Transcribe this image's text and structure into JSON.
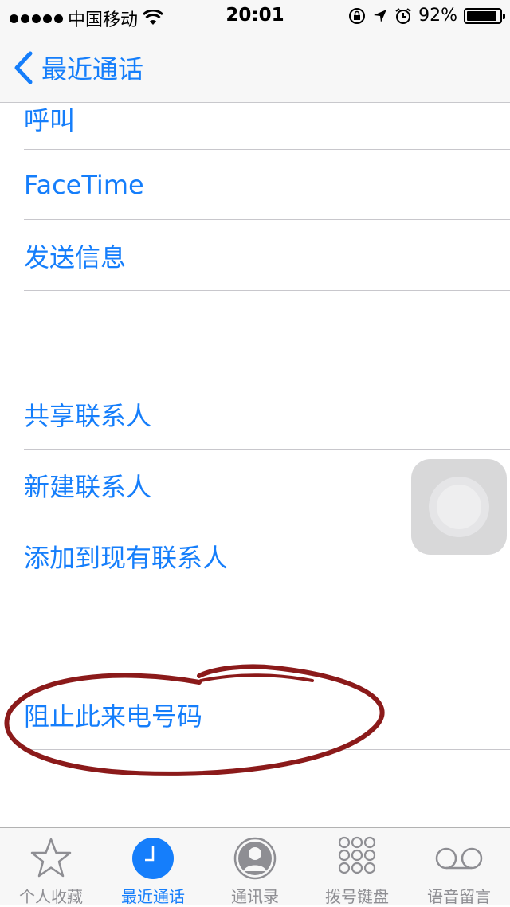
{
  "status_bar": {
    "carrier": "中国移动",
    "time": "20:01",
    "battery_percent": "92%",
    "battery_level": 0.92,
    "icons": [
      "signal-dots",
      "wifi-icon",
      "rotation-lock-icon",
      "location-icon",
      "alarm-icon",
      "battery-icon"
    ]
  },
  "nav": {
    "back_label": "最近通话"
  },
  "actions": {
    "call": "呼叫",
    "facetime": "FaceTime",
    "send_message": "发送信息",
    "share_contact": "共享联系人",
    "new_contact": "新建联系人",
    "add_to_existing": "添加到现有联系人",
    "block_caller": "阻止此来电号码"
  },
  "tabs": [
    {
      "label": "个人收藏",
      "icon": "star-icon"
    },
    {
      "label": "最近通话",
      "icon": "clock-icon",
      "active": true
    },
    {
      "label": "通讯录",
      "icon": "contacts-icon"
    },
    {
      "label": "拨号键盘",
      "icon": "keypad-icon"
    },
    {
      "label": "语音留言",
      "icon": "voicemail-icon"
    }
  ],
  "colors": {
    "accent": "#157efb",
    "annotation": "#8b1a1a",
    "separator": "#c8c7cc",
    "inactive": "#8e8e93"
  }
}
